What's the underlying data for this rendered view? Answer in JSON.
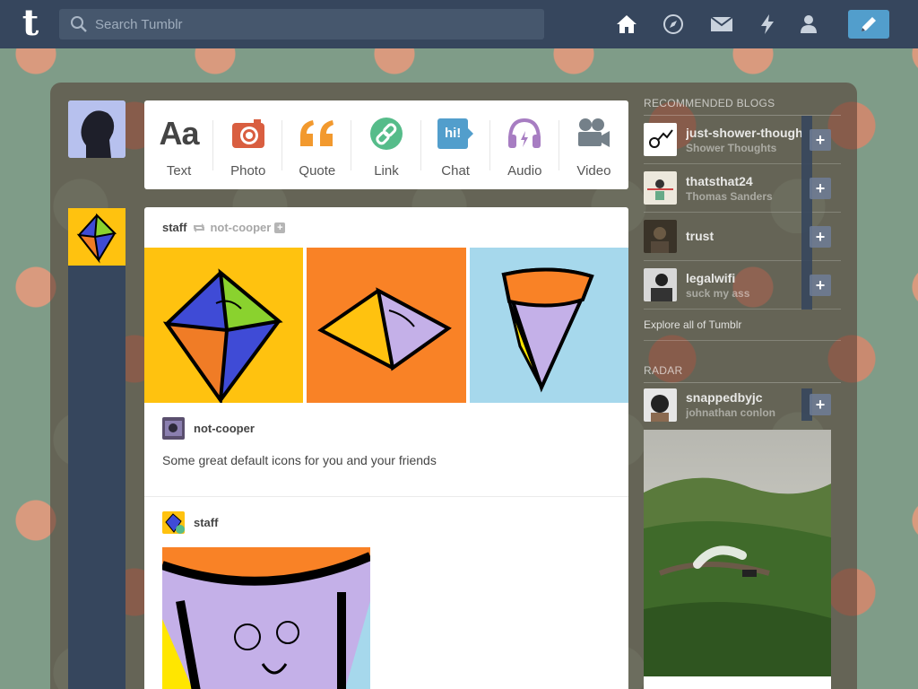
{
  "header": {
    "search_placeholder": "Search Tumblr",
    "nav_icons": [
      "home-icon",
      "explore-icon",
      "inbox-icon",
      "activity-icon",
      "account-icon",
      "compose-icon"
    ]
  },
  "post_types": [
    {
      "label": "Text",
      "icon": "text-icon",
      "glyph": "Aa",
      "color": "#444444"
    },
    {
      "label": "Photo",
      "icon": "camera-icon",
      "color": "#d95e40"
    },
    {
      "label": "Quote",
      "icon": "quote-icon",
      "glyph": "66",
      "color": "#f2992e"
    },
    {
      "label": "Link",
      "icon": "link-icon",
      "color": "#56bc8a"
    },
    {
      "label": "Chat",
      "icon": "chat-icon",
      "glyph": "hi!",
      "color": "#529ecc"
    },
    {
      "label": "Audio",
      "icon": "headphones-icon",
      "color": "#a77dc2"
    },
    {
      "label": "Video",
      "icon": "video-camera-icon",
      "color": "#748089"
    }
  ],
  "post": {
    "author": "staff",
    "reblogged_from": "not-cooper",
    "entries": [
      {
        "name": "not-cooper",
        "text": "Some great default icons for you and your friends"
      },
      {
        "name": "staff"
      }
    ]
  },
  "sidebar": {
    "recommended_heading": "RECOMMENDED BLOGS",
    "blogs": [
      {
        "name": "just-shower-thoughts",
        "subtitle": "Shower Thoughts"
      },
      {
        "name": "thatsthat24",
        "subtitle": "Thomas Sanders"
      },
      {
        "name": "trust",
        "subtitle": ""
      },
      {
        "name": "legalwifi",
        "subtitle": "suck my ass"
      }
    ],
    "explore_link": "Explore all of Tumblr",
    "radar_heading": "RADAR",
    "radar_blog": {
      "name": "snappedbyjc",
      "subtitle": "johnathan conlon"
    }
  },
  "colors": {
    "nav": "#36465d",
    "accent": "#529ecc"
  }
}
